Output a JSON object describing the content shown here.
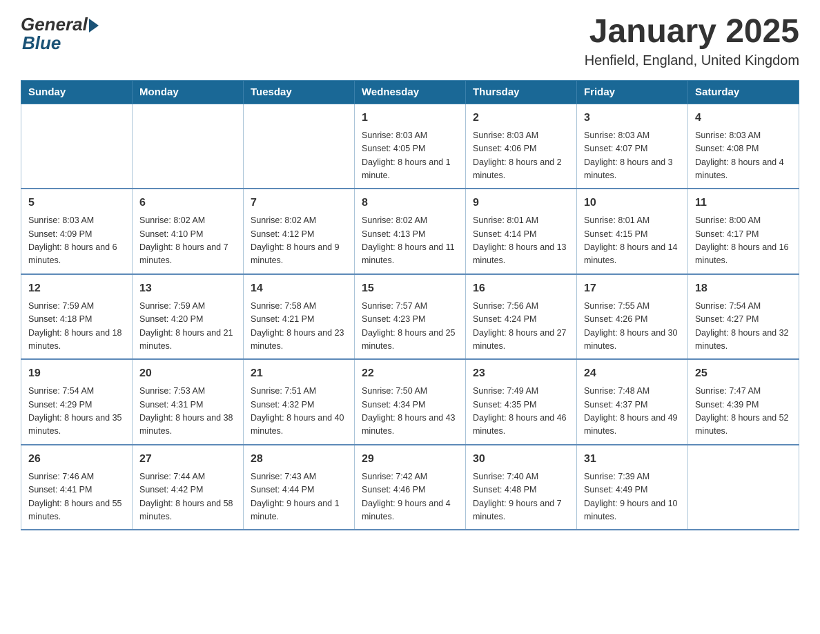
{
  "logo": {
    "general": "General",
    "blue": "Blue"
  },
  "title": "January 2025",
  "subtitle": "Henfield, England, United Kingdom",
  "weekdays": [
    "Sunday",
    "Monday",
    "Tuesday",
    "Wednesday",
    "Thursday",
    "Friday",
    "Saturday"
  ],
  "weeks": [
    [
      {
        "day": "",
        "info": ""
      },
      {
        "day": "",
        "info": ""
      },
      {
        "day": "",
        "info": ""
      },
      {
        "day": "1",
        "info": "Sunrise: 8:03 AM\nSunset: 4:05 PM\nDaylight: 8 hours and 1 minute."
      },
      {
        "day": "2",
        "info": "Sunrise: 8:03 AM\nSunset: 4:06 PM\nDaylight: 8 hours and 2 minutes."
      },
      {
        "day": "3",
        "info": "Sunrise: 8:03 AM\nSunset: 4:07 PM\nDaylight: 8 hours and 3 minutes."
      },
      {
        "day": "4",
        "info": "Sunrise: 8:03 AM\nSunset: 4:08 PM\nDaylight: 8 hours and 4 minutes."
      }
    ],
    [
      {
        "day": "5",
        "info": "Sunrise: 8:03 AM\nSunset: 4:09 PM\nDaylight: 8 hours and 6 minutes."
      },
      {
        "day": "6",
        "info": "Sunrise: 8:02 AM\nSunset: 4:10 PM\nDaylight: 8 hours and 7 minutes."
      },
      {
        "day": "7",
        "info": "Sunrise: 8:02 AM\nSunset: 4:12 PM\nDaylight: 8 hours and 9 minutes."
      },
      {
        "day": "8",
        "info": "Sunrise: 8:02 AM\nSunset: 4:13 PM\nDaylight: 8 hours and 11 minutes."
      },
      {
        "day": "9",
        "info": "Sunrise: 8:01 AM\nSunset: 4:14 PM\nDaylight: 8 hours and 13 minutes."
      },
      {
        "day": "10",
        "info": "Sunrise: 8:01 AM\nSunset: 4:15 PM\nDaylight: 8 hours and 14 minutes."
      },
      {
        "day": "11",
        "info": "Sunrise: 8:00 AM\nSunset: 4:17 PM\nDaylight: 8 hours and 16 minutes."
      }
    ],
    [
      {
        "day": "12",
        "info": "Sunrise: 7:59 AM\nSunset: 4:18 PM\nDaylight: 8 hours and 18 minutes."
      },
      {
        "day": "13",
        "info": "Sunrise: 7:59 AM\nSunset: 4:20 PM\nDaylight: 8 hours and 21 minutes."
      },
      {
        "day": "14",
        "info": "Sunrise: 7:58 AM\nSunset: 4:21 PM\nDaylight: 8 hours and 23 minutes."
      },
      {
        "day": "15",
        "info": "Sunrise: 7:57 AM\nSunset: 4:23 PM\nDaylight: 8 hours and 25 minutes."
      },
      {
        "day": "16",
        "info": "Sunrise: 7:56 AM\nSunset: 4:24 PM\nDaylight: 8 hours and 27 minutes."
      },
      {
        "day": "17",
        "info": "Sunrise: 7:55 AM\nSunset: 4:26 PM\nDaylight: 8 hours and 30 minutes."
      },
      {
        "day": "18",
        "info": "Sunrise: 7:54 AM\nSunset: 4:27 PM\nDaylight: 8 hours and 32 minutes."
      }
    ],
    [
      {
        "day": "19",
        "info": "Sunrise: 7:54 AM\nSunset: 4:29 PM\nDaylight: 8 hours and 35 minutes."
      },
      {
        "day": "20",
        "info": "Sunrise: 7:53 AM\nSunset: 4:31 PM\nDaylight: 8 hours and 38 minutes."
      },
      {
        "day": "21",
        "info": "Sunrise: 7:51 AM\nSunset: 4:32 PM\nDaylight: 8 hours and 40 minutes."
      },
      {
        "day": "22",
        "info": "Sunrise: 7:50 AM\nSunset: 4:34 PM\nDaylight: 8 hours and 43 minutes."
      },
      {
        "day": "23",
        "info": "Sunrise: 7:49 AM\nSunset: 4:35 PM\nDaylight: 8 hours and 46 minutes."
      },
      {
        "day": "24",
        "info": "Sunrise: 7:48 AM\nSunset: 4:37 PM\nDaylight: 8 hours and 49 minutes."
      },
      {
        "day": "25",
        "info": "Sunrise: 7:47 AM\nSunset: 4:39 PM\nDaylight: 8 hours and 52 minutes."
      }
    ],
    [
      {
        "day": "26",
        "info": "Sunrise: 7:46 AM\nSunset: 4:41 PM\nDaylight: 8 hours and 55 minutes."
      },
      {
        "day": "27",
        "info": "Sunrise: 7:44 AM\nSunset: 4:42 PM\nDaylight: 8 hours and 58 minutes."
      },
      {
        "day": "28",
        "info": "Sunrise: 7:43 AM\nSunset: 4:44 PM\nDaylight: 9 hours and 1 minute."
      },
      {
        "day": "29",
        "info": "Sunrise: 7:42 AM\nSunset: 4:46 PM\nDaylight: 9 hours and 4 minutes."
      },
      {
        "day": "30",
        "info": "Sunrise: 7:40 AM\nSunset: 4:48 PM\nDaylight: 9 hours and 7 minutes."
      },
      {
        "day": "31",
        "info": "Sunrise: 7:39 AM\nSunset: 4:49 PM\nDaylight: 9 hours and 10 minutes."
      },
      {
        "day": "",
        "info": ""
      }
    ]
  ]
}
